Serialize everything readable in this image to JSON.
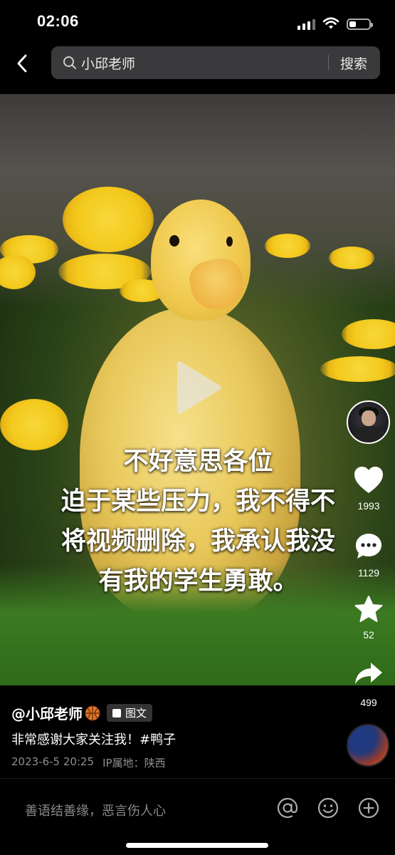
{
  "status_bar": {
    "time": "02:06"
  },
  "search": {
    "query": "小邱老师",
    "button_label": "搜索"
  },
  "video": {
    "caption_lines": [
      "不好意思各位",
      "迫于某些压力，我不得不",
      "将视频删除，我承认我没",
      "有我的学生勇敢。"
    ]
  },
  "actions": {
    "likes": "1993",
    "comments": "1129",
    "favorites": "52",
    "shares": "499"
  },
  "post": {
    "author": "@小邱老师",
    "tag": "图文",
    "description": "非常感谢大家关注我！#鸭子",
    "date": "2023-6-5 20:25",
    "ip_location": "IP属地：陕西"
  },
  "comment_bar": {
    "placeholder": "善语结善缘，恶言伤人心"
  }
}
